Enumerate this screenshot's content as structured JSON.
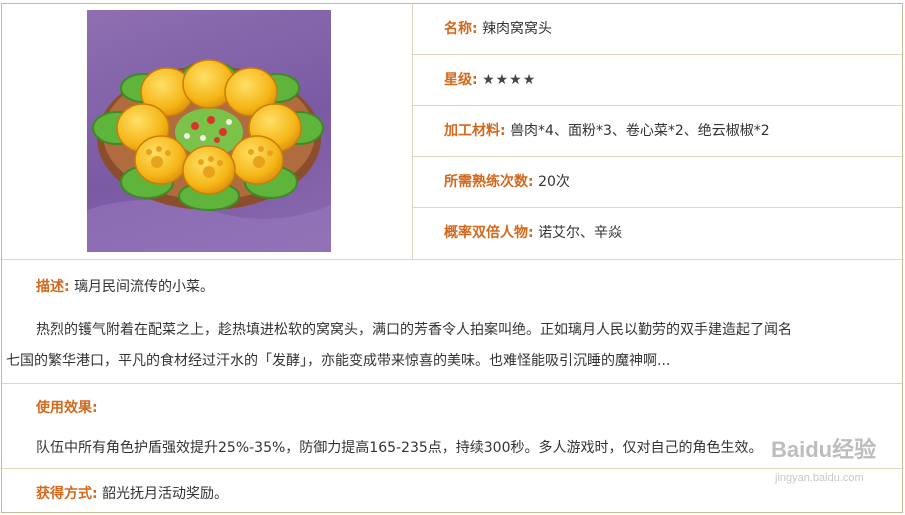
{
  "item": {
    "name_label": "名称:",
    "name": "辣肉窝窝头",
    "rarity_label": "星级:",
    "rarity": "★★★★",
    "materials_label": "加工材料:",
    "materials": "兽肉*4、面粉*3、卷心菜*2、绝云椒椒*2",
    "proficiency_label": "所需熟练次数:",
    "proficiency": "20次",
    "double_label": "概率双倍人物:",
    "double": "诺艾尔、辛焱",
    "image_name": "spicy-meat-wowotou-dish"
  },
  "description": {
    "label": "描述:",
    "short": "璃月民间流传的小菜。",
    "line1": "热烈的镬气附着在配菜之上，趁热填进松软的窝窝头，满口的芳香令人拍案叫绝。正如璃月人民以勤劳的双手建造起了闻名",
    "line2": "七国的繁华港口，平凡的食材经过汗水的「发酵」，亦能变成带来惊喜的美味。也难怪能吸引沉睡的魔神啊..."
  },
  "effect": {
    "label": "使用效果:",
    "text": "队伍中所有角色护盾强效提升25%-35%，防御力提高165-235点，持续300秒。多人游戏时，仅对自己的角色生效。"
  },
  "source": {
    "label": "获得方式:",
    "text": "韶光抚月活动奖励。"
  },
  "watermark": {
    "brand": "Baidu经验",
    "url": "jingyan.baidu.com"
  },
  "colors": {
    "label": "#d2691e",
    "border": "#e2d5bb",
    "image_bg": "#7a5aa3"
  }
}
